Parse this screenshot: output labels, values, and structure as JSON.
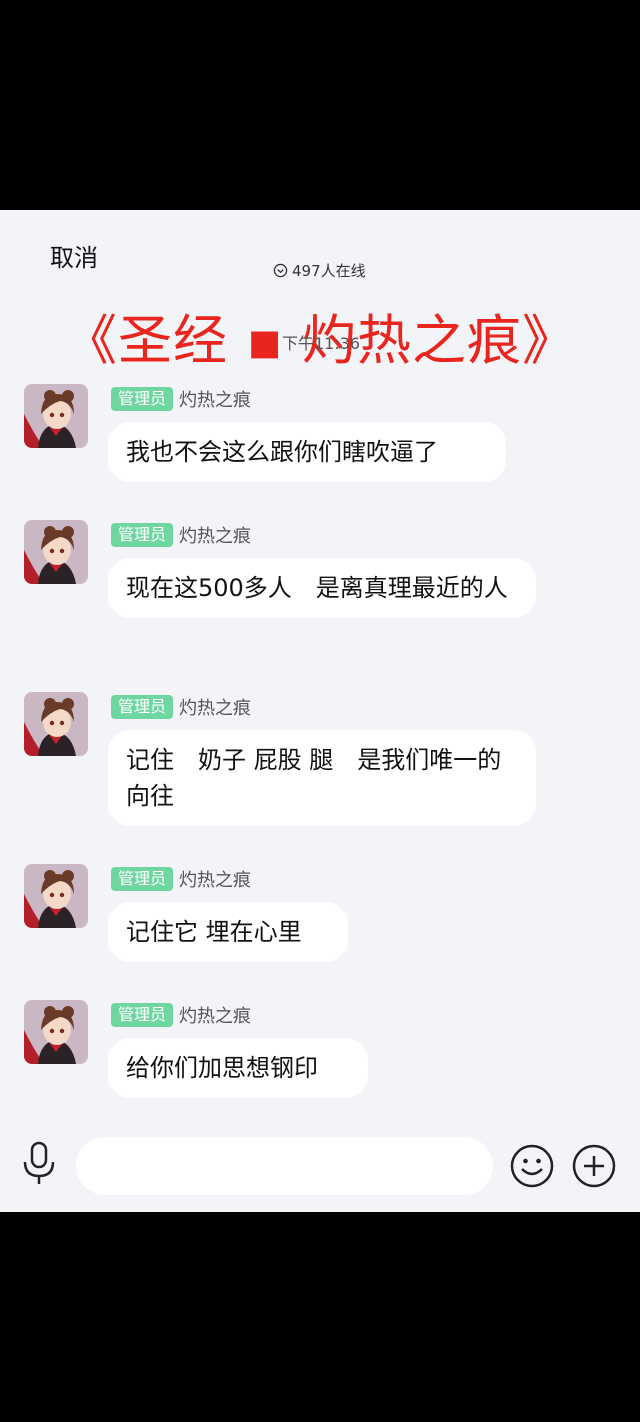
{
  "header": {
    "cancel_label": "取消",
    "online_count": "497人在线",
    "title": "《圣经 ▪ 灼热之痕》",
    "time": "下午11:36"
  },
  "messages": [
    {
      "badge": "管理员",
      "sender": "灼热之痕",
      "text": "我也不会这么跟你们瞎吹逼了"
    },
    {
      "badge": "管理员",
      "sender": "灼热之痕",
      "text": "现在这500多人　是离真理最近的人"
    },
    {
      "badge": "管理员",
      "sender": "灼热之痕",
      "text": "记住　奶子 屁股 腿　是我们唯一的向往"
    },
    {
      "badge": "管理员",
      "sender": "灼热之痕",
      "text": "记住它 埋在心里"
    },
    {
      "badge": "管理员",
      "sender": "灼热之痕",
      "text": "给你们加思想钢印"
    }
  ],
  "input": {
    "value": "",
    "placeholder": ""
  },
  "colors": {
    "title": "#e8261f",
    "badge": "#6fd6a1",
    "background": "#f3f4f8"
  },
  "icons": [
    "chevron-down-circle-icon",
    "mic-icon",
    "emoji-icon",
    "plus-icon"
  ]
}
